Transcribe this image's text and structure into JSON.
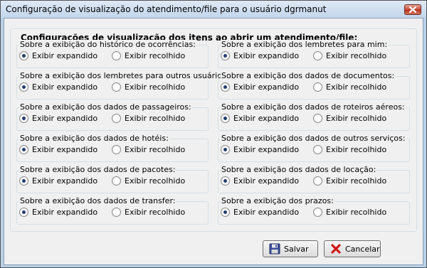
{
  "window": {
    "title": "Configuração de visualização do atendimento/file para o usuário dgrmanut"
  },
  "main_group": {
    "legend": "Configurações de visualização dos itens ao abrir um atendimento/file:"
  },
  "options": {
    "expanded_label": "Exibir expandido",
    "collapsed_label": "Exibir recolhido"
  },
  "groups": [
    {
      "label": "Sobre a exibição do histórico de ocorrências:",
      "selected": "expanded"
    },
    {
      "label": "Sobre a exibição dos lembretes para mim:",
      "selected": "expanded"
    },
    {
      "label": "Sobre a exibição dos lembretes para outros usuários:",
      "selected": "expanded"
    },
    {
      "label": "Sobre a exibição dos dados de documentos:",
      "selected": "expanded"
    },
    {
      "label": "Sobre a exibição dos dados de passageiros:",
      "selected": "expanded"
    },
    {
      "label": "Sobre a exibição dos dados de roteiros aéreos:",
      "selected": "expanded"
    },
    {
      "label": "Sobre a exibição dos dados de hotéis:",
      "selected": "expanded"
    },
    {
      "label": "Sobre a exibição dos dados de outros serviços:",
      "selected": "expanded"
    },
    {
      "label": "Sobre a exibição dos dados de pacotes:",
      "selected": "expanded"
    },
    {
      "label": "Sobre a exibição dos dados de locação:",
      "selected": "expanded"
    },
    {
      "label": "Sobre a exibição dos dados de transfer:",
      "selected": "expanded"
    },
    {
      "label": "Sobre a exibição dos prazos:",
      "selected": "expanded"
    }
  ],
  "buttons": {
    "save_label": "Salvar",
    "cancel_label": "Cancelar"
  },
  "icons": {
    "save": "floppy-disk-icon",
    "cancel": "red-x-icon",
    "close": "close-icon"
  }
}
